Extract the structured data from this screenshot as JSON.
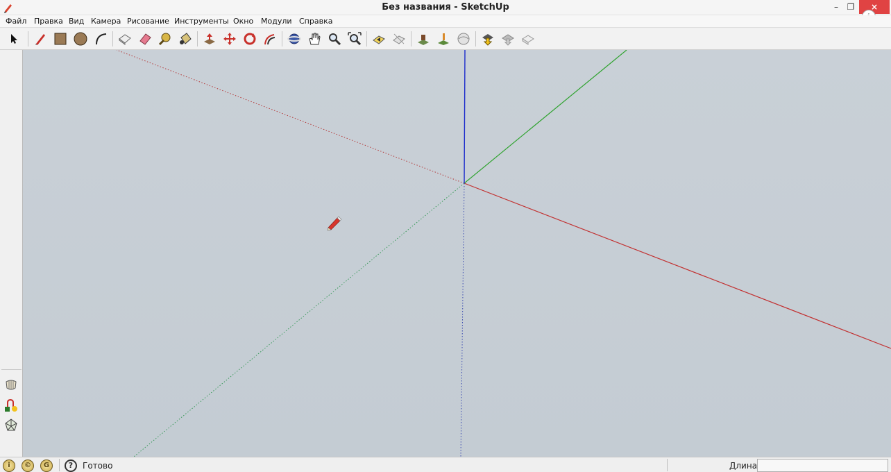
{
  "window": {
    "title": "Без названия - SketchUp",
    "minimize_glyph": "–",
    "maximize_glyph": "❐",
    "close_glyph": "×",
    "info_glyph": "i"
  },
  "menu": [
    "Файл",
    "Правка",
    "Вид",
    "Камера",
    "Рисование",
    "Инструменты",
    "Окно",
    "Модули",
    "Справка"
  ],
  "toolbar_icons": [
    "select-icon",
    "line-pencil-icon",
    "rectangle-icon",
    "circle-icon",
    "arc-icon",
    "make-component-icon",
    "eraser-icon",
    "tape-measure-icon",
    "paint-bucket-icon",
    "push-pull-icon",
    "move-icon",
    "rotate-icon",
    "offset-icon",
    "orbit-icon",
    "pan-icon",
    "zoom-icon",
    "zoom-extents-icon",
    "previous-view-icon",
    "next-view-icon",
    "add-location-icon",
    "toggle-terrain-icon",
    "get-models-icon",
    "share-model-icon",
    "share-component-icon",
    "extension-warehouse-icon"
  ],
  "left_tools": [
    "sandbox-icon",
    "follow-me-icon",
    "geometry-icon"
  ],
  "viewport": {
    "axes": {
      "red": "#cc2a2a",
      "green": "#2fa32f",
      "blue": "#1b2bcc"
    },
    "background": "#c7cfd6"
  },
  "statusbar": {
    "circle_icons": [
      "geo-location-icon",
      "credits-icon",
      "sign-in-icon"
    ],
    "circle_glyphs": [
      "i",
      "©",
      "G"
    ],
    "help_glyph": "?",
    "status_text": "Готово",
    "measure_label": "Длина",
    "measure_value": ""
  }
}
